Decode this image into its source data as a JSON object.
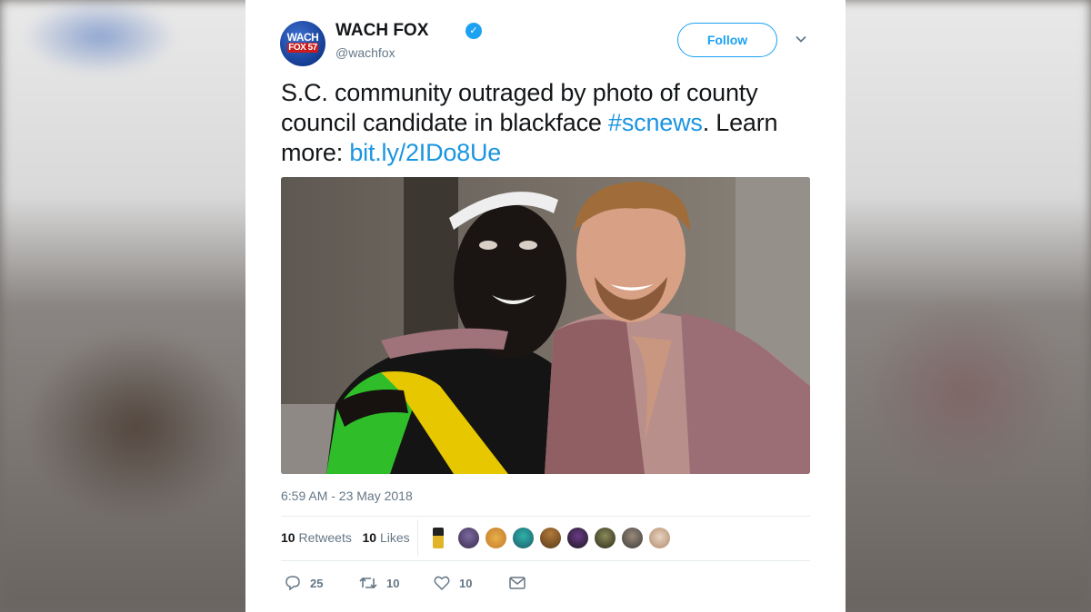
{
  "account": {
    "name": "WACH FOX",
    "handle": "@wachfox",
    "avatar_top": "WACH",
    "avatar_bottom": "FOX 57"
  },
  "follow_label": "Follow",
  "tweet": {
    "text_before": "S.C. community outraged by photo of county council candidate in blackface ",
    "hashtag": "#scnews",
    "text_after": ". Learn more: ",
    "link": "bit.ly/2IDo8Ue"
  },
  "timestamp": "6:59 AM - 23 May 2018",
  "stats": {
    "retweets_count": "10",
    "retweets_label": "Retweets",
    "likes_count": "10",
    "likes_label": "Likes"
  },
  "actions": {
    "replies": "25",
    "retweets": "10",
    "likes": "10"
  },
  "colors": {
    "accent": "#1da1f2",
    "link": "#1b95e0",
    "muted": "#657786",
    "text": "#14171a"
  },
  "icons": [
    "verified-badge-icon",
    "chevron-down-icon",
    "reply-icon",
    "retweet-icon",
    "heart-icon",
    "direct-message-icon"
  ]
}
